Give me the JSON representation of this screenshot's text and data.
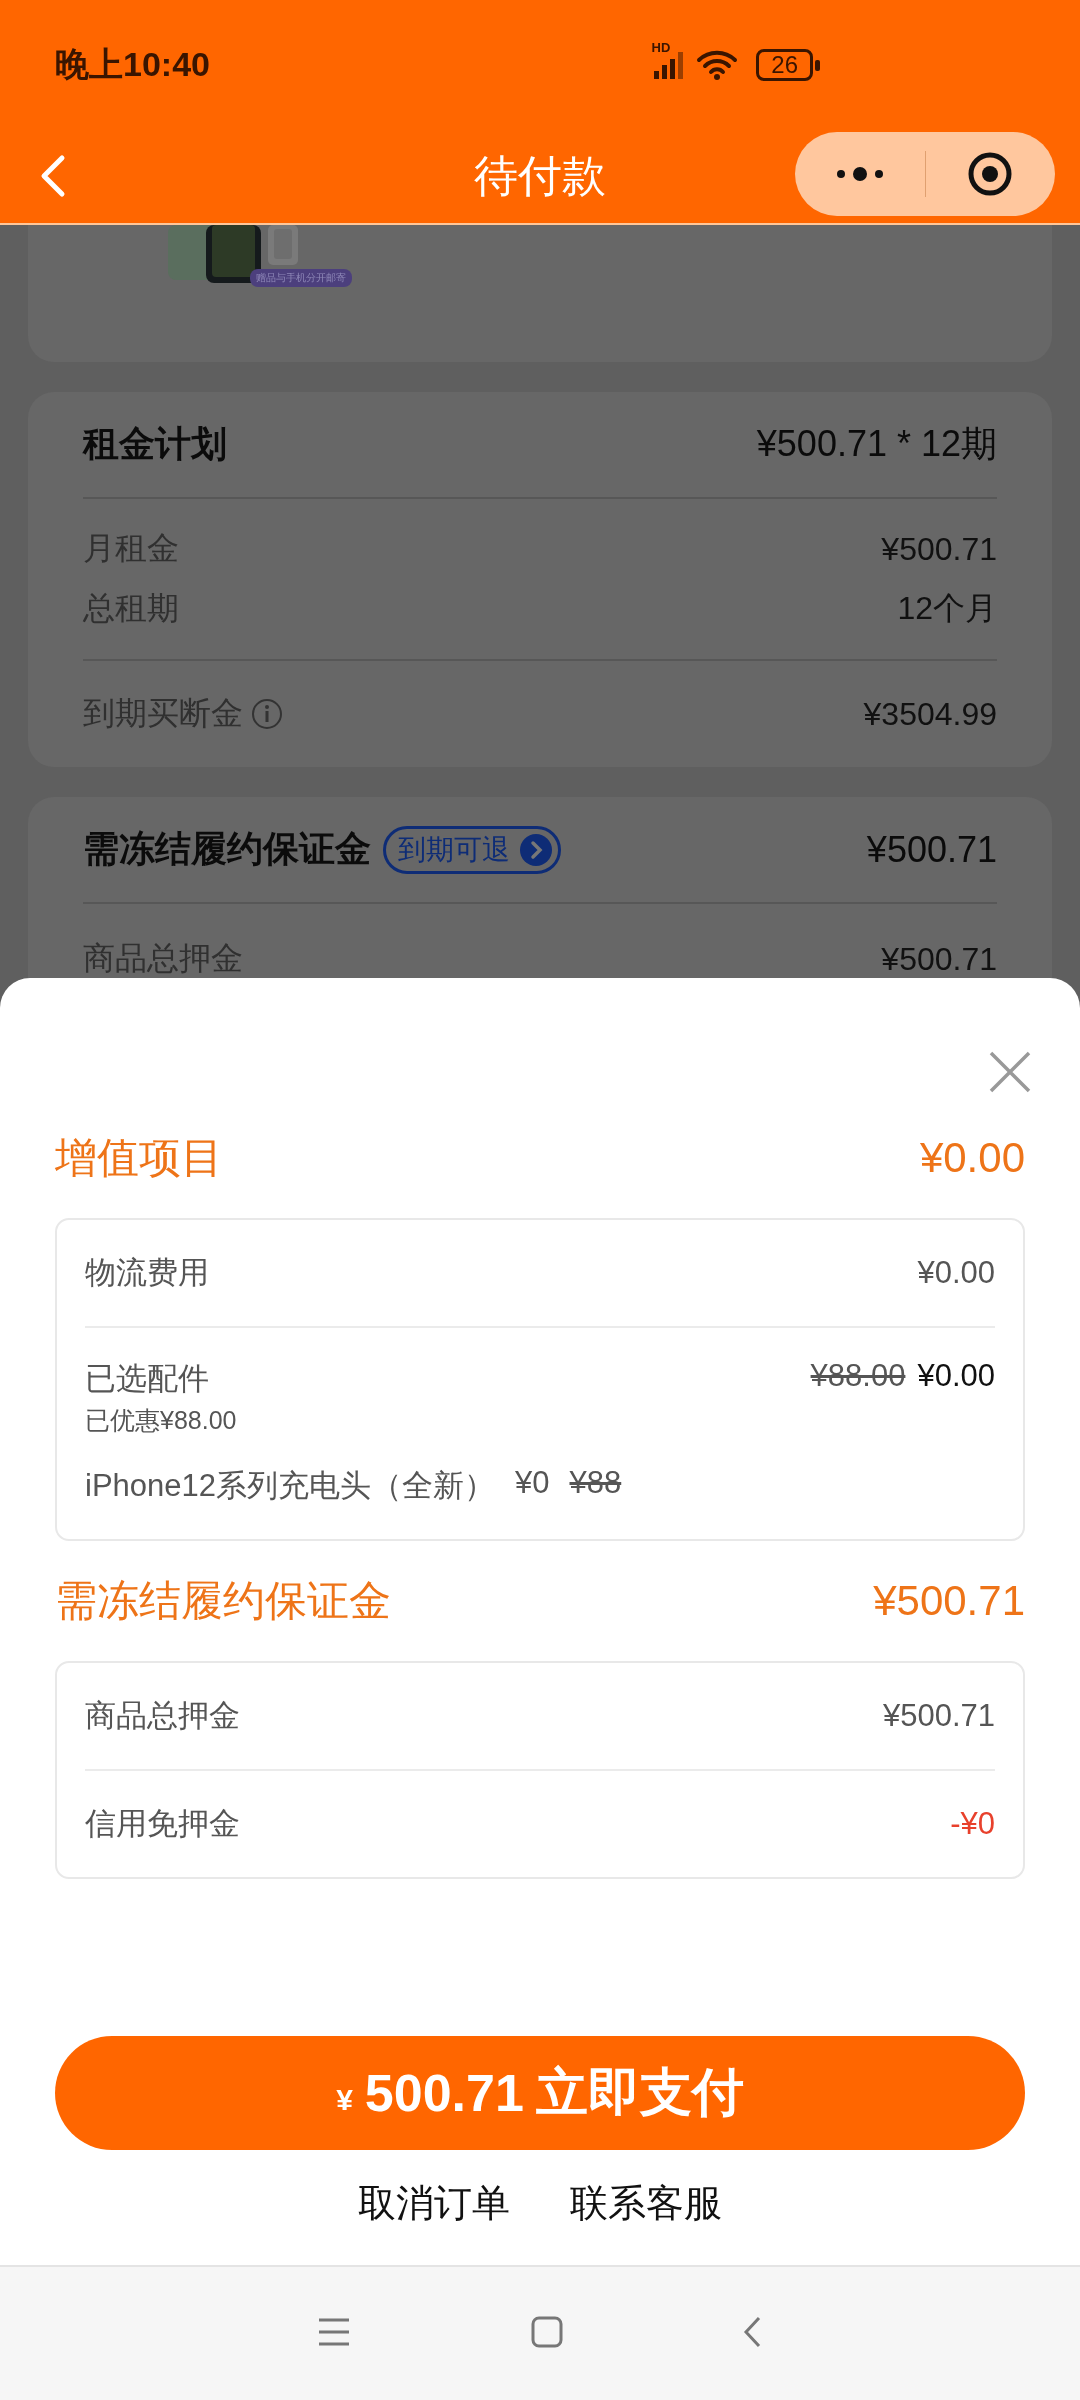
{
  "status_bar": {
    "time": "晚上10:40",
    "network": "HD",
    "battery": "26"
  },
  "nav": {
    "title": "待付款"
  },
  "product_card": {
    "badge": "赠品与手机分开邮寄"
  },
  "rent_plan": {
    "title": "租金计划",
    "summary": "¥500.71 * 12期",
    "rows": [
      {
        "label": "月租金",
        "value": "¥500.71"
      },
      {
        "label": "总租期",
        "value": "12个月"
      }
    ],
    "buyout": {
      "label": "到期买断金",
      "value": "¥3504.99"
    }
  },
  "deposit_card": {
    "title": "需冻结履约保证金",
    "tag": "到期可退",
    "amount": "¥500.71",
    "rows": [
      {
        "label": "商品总押金",
        "value": "¥500.71"
      }
    ]
  },
  "sheet": {
    "sections": [
      {
        "title": "增值项目",
        "amount": "¥0.00",
        "rows": [
          {
            "kind": "fee",
            "label": "物流费用",
            "value": "¥0.00"
          },
          {
            "kind": "accessory",
            "label": "已选配件",
            "note": "已优惠¥88.00",
            "original_price": "¥88.00",
            "value": "¥0.00",
            "items": [
              {
                "name": "iPhone12系列充电头（全新）",
                "price": "¥0",
                "original_price": "¥88"
              }
            ]
          }
        ]
      },
      {
        "title": "需冻结履约保证金",
        "amount": "¥500.71",
        "rows": [
          {
            "kind": "fee",
            "label": "商品总押金",
            "value": "¥500.71"
          },
          {
            "kind": "deduction",
            "label": "信用免押金",
            "value": "-¥0"
          }
        ]
      }
    ]
  },
  "pay_button": {
    "currency": "¥",
    "amount": "500.71",
    "label": "立即支付"
  },
  "links": [
    "取消订单",
    "联系客服"
  ]
}
